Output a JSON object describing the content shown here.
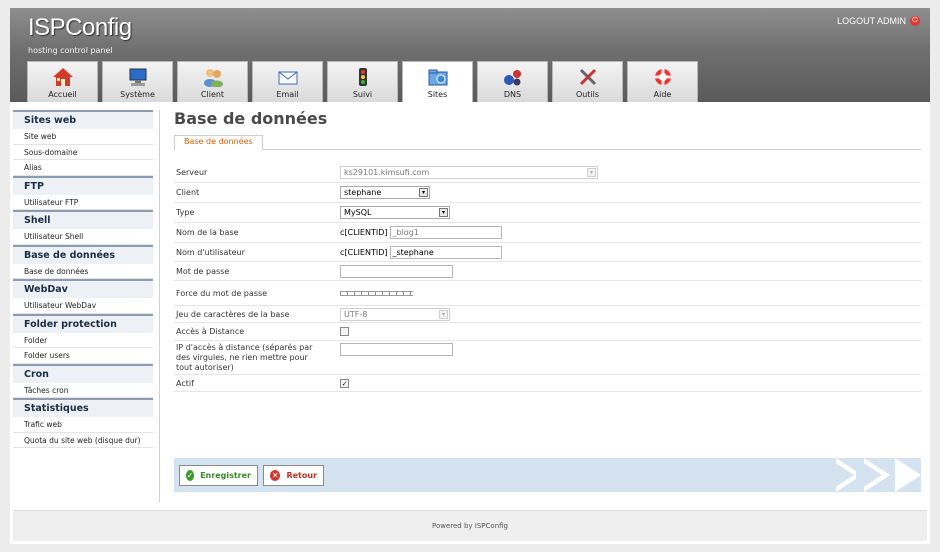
{
  "header": {
    "logo": "ISPConfig",
    "tagline": "hosting control panel",
    "logout_label": "LOGOUT ADMIN"
  },
  "tabs": [
    {
      "label": "Accueil",
      "icon": "home-icon",
      "active": false
    },
    {
      "label": "Système",
      "icon": "system-monitor-icon",
      "active": false
    },
    {
      "label": "Client",
      "icon": "client-users-icon",
      "active": false
    },
    {
      "label": "Email",
      "icon": "email-envelope-icon",
      "active": false
    },
    {
      "label": "Suivi",
      "icon": "traffic-light-icon",
      "active": false
    },
    {
      "label": "Sites",
      "icon": "sites-folder-icon",
      "active": true
    },
    {
      "label": "DNS",
      "icon": "dns-network-icon",
      "active": false
    },
    {
      "label": "Outils",
      "icon": "tools-icon",
      "active": false
    },
    {
      "label": "Aide",
      "icon": "help-lifebuoy-icon",
      "active": false
    }
  ],
  "sidebar": {
    "sections": [
      {
        "title": "Sites web",
        "items": [
          "Site web",
          "Sous-domaine",
          "Alias"
        ]
      },
      {
        "title": "FTP",
        "items": [
          "Utilisateur FTP"
        ]
      },
      {
        "title": "Shell",
        "items": [
          "Utilisateur Shell"
        ]
      },
      {
        "title": "Base de données",
        "items": [
          "Base de données"
        ]
      },
      {
        "title": "WebDav",
        "items": [
          "Utilisateur WebDav"
        ]
      },
      {
        "title": "Folder protection",
        "items": [
          "Folder",
          "Folder users"
        ]
      },
      {
        "title": "Cron",
        "items": [
          "Tâches cron"
        ]
      },
      {
        "title": "Statistiques",
        "items": [
          "Trafic web",
          "Quota du site web (disque dur)"
        ]
      }
    ]
  },
  "main": {
    "title": "Base de données",
    "subtab": "Base de données",
    "form": {
      "serveur_label": "Serveur",
      "serveur_value": "ks29101.kimsufi.com",
      "client_label": "Client",
      "client_value": "stephane",
      "type_label": "Type",
      "type_value": "MySQL",
      "nom_base_label": "Nom de la base",
      "nom_base_prefix": "c[CLIENTID]",
      "nom_base_value": "_blog1",
      "nom_user_label": "Nom d'utilisateur",
      "nom_user_prefix": "c[CLIENTID]",
      "nom_user_value": "_stephane",
      "password_label": "Mot de passe",
      "password_value": "",
      "strength_label": "Force du mot de passe",
      "charset_label": "Jeu de caractères de la base",
      "charset_value": "UTF-8",
      "remote_label": "Accès à Distance",
      "remote_checked": false,
      "remote_ip_label": "IP d'accès à distance (séparés par des virgules, ne rien mettre pour tout autoriser)",
      "remote_ip_value": "",
      "actif_label": "Actif",
      "actif_checked": true
    },
    "buttons": {
      "save_label": "Enregistrer",
      "back_label": "Retour"
    }
  },
  "footer": {
    "powered_by": "Powered by",
    "brand": "ISPConfig"
  },
  "colors": {
    "header_gray": "#6f6f6f",
    "accent_orange": "#e06000",
    "sidebar_title": "#1d2e44",
    "button_bar": "#d5e3f0",
    "save_green": "#3a9a2a",
    "back_red": "#d03a2e"
  }
}
